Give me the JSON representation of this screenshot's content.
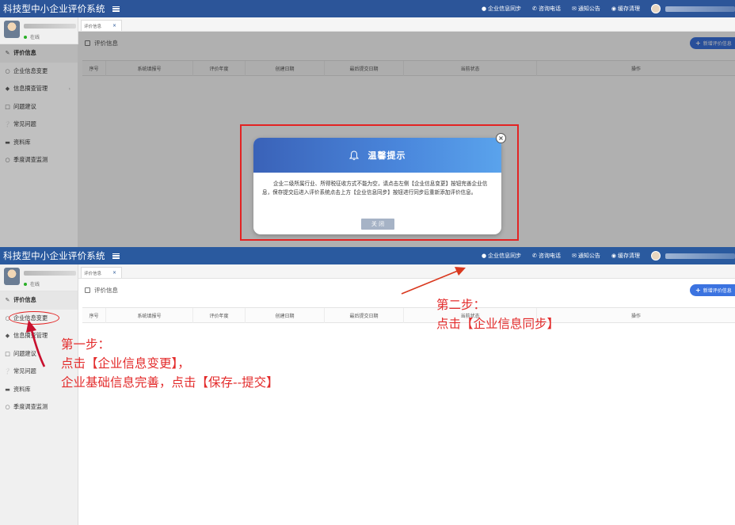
{
  "app": {
    "title": "科技型中小企业评价系统",
    "top_actions": [
      {
        "icon": "user-icon",
        "label": "企业信息同步"
      },
      {
        "icon": "phone-icon",
        "label": "咨询电话"
      },
      {
        "icon": "notice-icon",
        "label": "通知公告"
      },
      {
        "icon": "clear-cache-icon",
        "label": "缓存清理"
      }
    ],
    "colors": {
      "topbar": "#2c5599",
      "accent": "#3b73e0",
      "annotation": "#e32b2b"
    }
  },
  "user": {
    "status": "在线"
  },
  "sidebar": {
    "items": [
      {
        "icon": "edit-icon",
        "label": "评价信息"
      },
      {
        "icon": "circle-icon",
        "label": "企业信息变更"
      },
      {
        "icon": "tag-icon",
        "label": "信息摘查管理"
      },
      {
        "icon": "chat-icon",
        "label": "问题建议"
      },
      {
        "icon": "question-icon",
        "label": "常见问题"
      },
      {
        "icon": "folder-icon",
        "label": "资料库"
      },
      {
        "icon": "circle-icon",
        "label": "季度调查监测"
      }
    ]
  },
  "tab": {
    "label": "评价信息",
    "close": "×"
  },
  "panel": {
    "title": "评价信息",
    "add_button": "新增评价信息"
  },
  "table": {
    "headers": [
      "序号",
      "系统填报号",
      "评价年度",
      "创建日期",
      "最后提交日期",
      "当前状态",
      "操作"
    ]
  },
  "modal": {
    "title": "温馨提示",
    "body": "企业二级所属行业、所得税征收方式不能为空，请点击左侧【企业信息变更】按钮完善企业信息，保存提交后进入评价系统点击上方【企业信息同步】按钮进行同步后重新添加评价信息。",
    "close_button": "关 闭",
    "close_icon": "×"
  },
  "annotations": {
    "step2_line1": "第二步：",
    "step2_line2": "点击【企业信息同步】",
    "step1_line1": "第一步：",
    "step1_line2": "点击【企业信息变更】，",
    "step1_line3": "企业基础信息完善，点击【保存--提交】"
  }
}
